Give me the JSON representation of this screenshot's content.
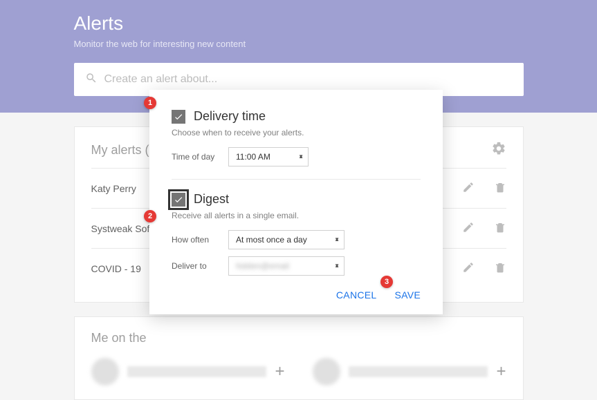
{
  "header": {
    "title": "Alerts",
    "subtitle": "Monitor the web for interesting new content",
    "search_placeholder": "Create an alert about..."
  },
  "my_alerts": {
    "heading": "My alerts (",
    "items": [
      {
        "name": "Katy Perry"
      },
      {
        "name": "Systweak Soft"
      },
      {
        "name": "COVID - 19"
      }
    ]
  },
  "me_section": {
    "heading": "Me on the"
  },
  "dialog": {
    "delivery": {
      "title": "Delivery time",
      "subtitle": "Choose when to receive your alerts.",
      "time_label": "Time of day",
      "time_value": "11:00 AM",
      "checked": true
    },
    "digest": {
      "title": "Digest",
      "subtitle": "Receive all alerts in a single email.",
      "how_often_label": "How often",
      "how_often_value": "At most once a day",
      "deliver_to_label": "Deliver to",
      "deliver_to_value": "",
      "checked": true
    },
    "cancel_label": "CANCEL",
    "save_label": "SAVE"
  },
  "annotations": {
    "badge1": "1",
    "badge2": "2",
    "badge3": "3"
  }
}
